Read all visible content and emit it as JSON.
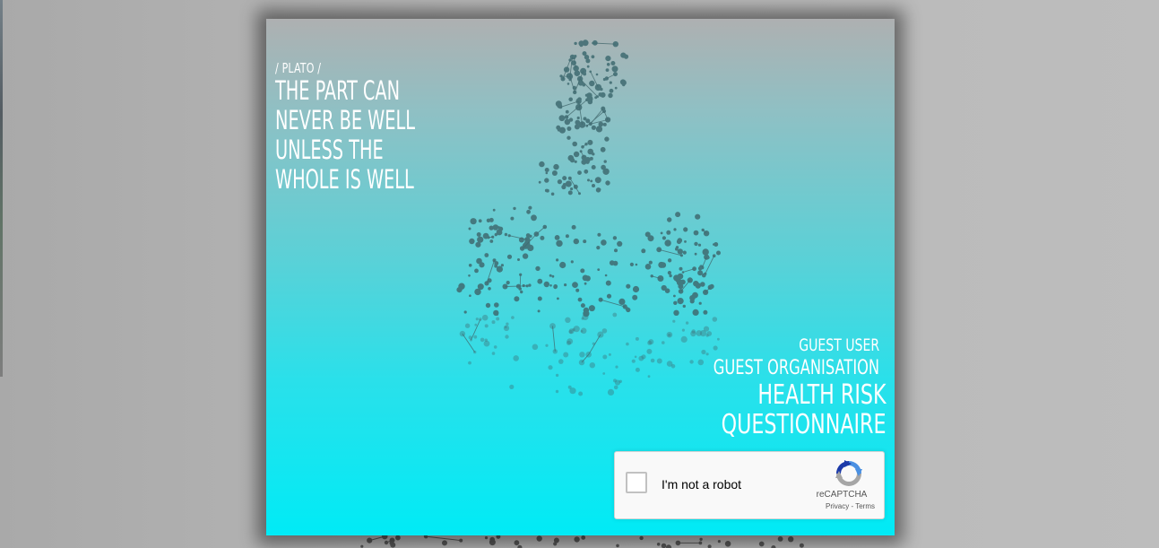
{
  "quote": {
    "author": "/ PLATO /",
    "lines": [
      "THE PART CAN",
      "NEVER BE WELL",
      "UNLESS THE",
      "WHOLE IS WELL"
    ]
  },
  "info": {
    "user": "GUEST USER",
    "organisation": "GUEST ORGANISATION",
    "title_lines": [
      "HEALTH RISK",
      "QUESTIONNAIRE"
    ]
  },
  "recaptcha": {
    "label": "I'm not a robot",
    "brand": "reCAPTCHA",
    "privacy": "Privacy",
    "separator": " - ",
    "terms": "Terms",
    "checked": false
  },
  "colors": {
    "card_top": "#aeb0b1",
    "card_bottom": "#00ebf6",
    "network_nodes": "#3d6e74",
    "recaptcha_blue": "#4a90e2",
    "recaptcha_gray": "#a6a6a6"
  },
  "icons": {
    "recaptcha_logo": "recaptcha-logo-icon",
    "checkbox": "checkbox-icon"
  }
}
